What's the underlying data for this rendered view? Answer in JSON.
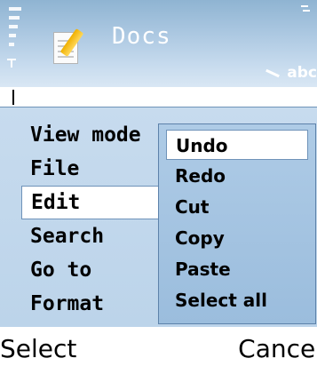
{
  "header": {
    "app_title": "Docs",
    "input_mode": "abc",
    "app_icon": "document-edit-icon",
    "signal_icon": "signal-strength-icon",
    "battery_icon": "battery-icon",
    "input_icon": "pen-input-icon"
  },
  "main_menu": {
    "items": [
      {
        "label": "View mode"
      },
      {
        "label": "File"
      },
      {
        "label": "Edit"
      },
      {
        "label": "Search"
      },
      {
        "label": "Go to"
      },
      {
        "label": "Format"
      }
    ],
    "selected_index": 2
  },
  "edit_submenu": {
    "items": [
      {
        "label": "Undo"
      },
      {
        "label": "Redo"
      },
      {
        "label": "Cut"
      },
      {
        "label": "Copy"
      },
      {
        "label": "Paste"
      },
      {
        "label": "Select all"
      }
    ],
    "selected_index": 0
  },
  "softkeys": {
    "left": "Select",
    "right": "Cancel"
  },
  "colors": {
    "header_top": "#8fb4d2",
    "menu_background": "#c7dbee",
    "submenu_background": "#aecbe6",
    "selection": "#ffffff",
    "border": "#6f93b9"
  }
}
